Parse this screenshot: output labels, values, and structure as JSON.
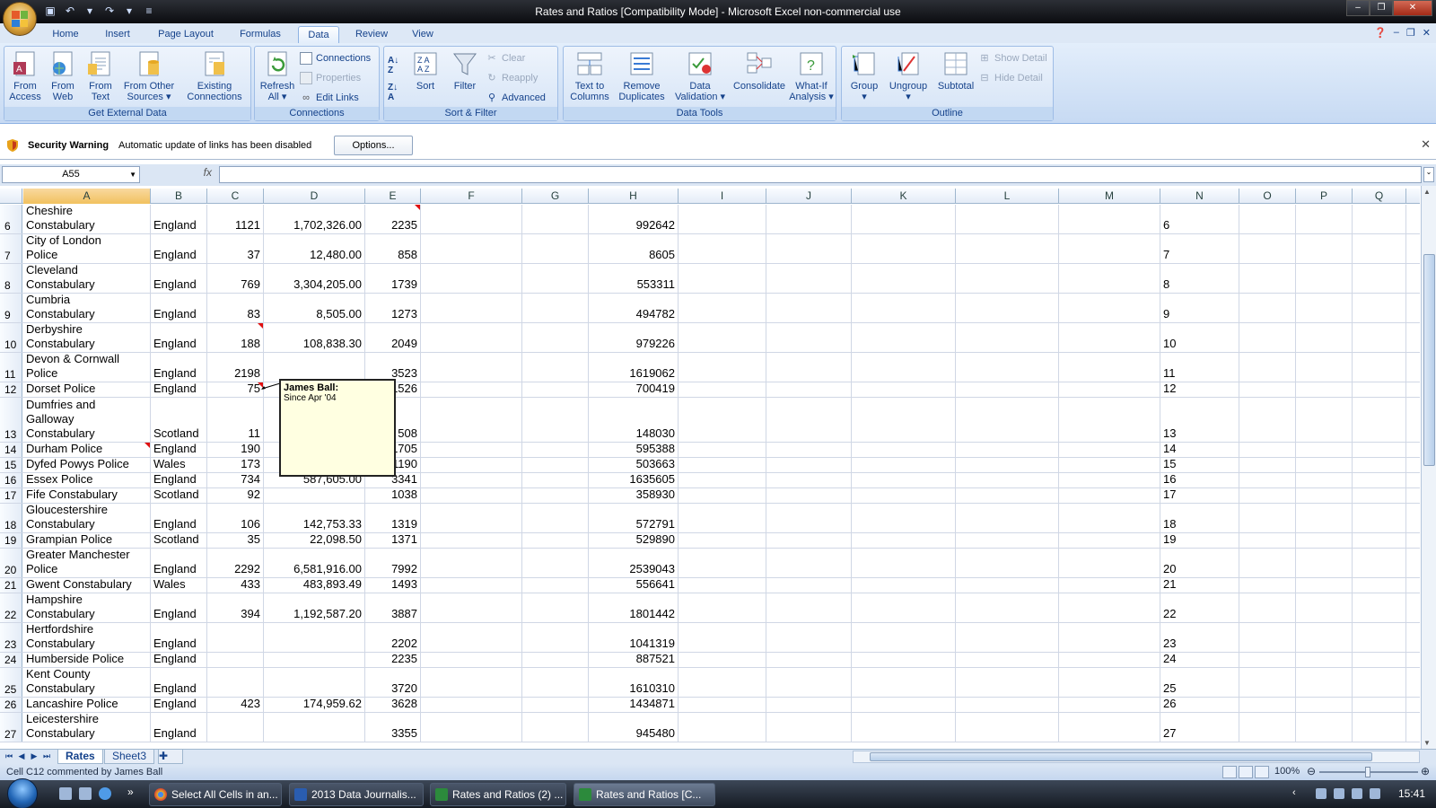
{
  "window": {
    "title": "Rates and Ratios  [Compatibility Mode] - Microsoft Excel non-commercial use"
  },
  "ribbon": {
    "tabs": [
      {
        "label": "Home"
      },
      {
        "label": "Insert"
      },
      {
        "label": "Page Layout"
      },
      {
        "label": "Formulas"
      },
      {
        "label": "Data",
        "active": true
      },
      {
        "label": "Review"
      },
      {
        "label": "View"
      }
    ],
    "groups": {
      "get_external_data": {
        "label": "Get External Data",
        "buttons": [
          {
            "label": "From\nAccess"
          },
          {
            "label": "From\nWeb"
          },
          {
            "label": "From\nText"
          },
          {
            "label": "From Other\nSources ▾"
          },
          {
            "label": "Existing\nConnections"
          }
        ]
      },
      "connections": {
        "label": "Connections",
        "refresh": "Refresh\nAll ▾",
        "connections": "Connections",
        "properties": "Properties",
        "edit_links": "Edit Links"
      },
      "sort_filter": {
        "label": "Sort & Filter",
        "sort": "Sort",
        "filter": "Filter",
        "clear": "Clear",
        "reapply": "Reapply",
        "advanced": "Advanced"
      },
      "data_tools": {
        "label": "Data Tools",
        "buttons": [
          {
            "label": "Text to\nColumns"
          },
          {
            "label": "Remove\nDuplicates"
          },
          {
            "label": "Data\nValidation ▾"
          },
          {
            "label": "Consolidate"
          },
          {
            "label": "What-If\nAnalysis ▾"
          }
        ]
      },
      "outline": {
        "label": "Outline",
        "buttons": [
          {
            "label": "Group\n▾"
          },
          {
            "label": "Ungroup\n▾"
          },
          {
            "label": "Subtotal"
          }
        ],
        "show_detail": "Show Detail",
        "hide_detail": "Hide Detail"
      }
    }
  },
  "security_bar": {
    "title": "Security Warning",
    "message": "Automatic update of links has been disabled",
    "options_button": "Options..."
  },
  "formula_bar": {
    "name_box": "A55",
    "fx": "fx",
    "formula": ""
  },
  "grid": {
    "columns": [
      "A",
      "B",
      "C",
      "D",
      "E",
      "F",
      "G",
      "H",
      "I",
      "J",
      "K",
      "L",
      "M",
      "N",
      "O",
      "P",
      "Q"
    ],
    "selected_column": "A",
    "rows": [
      {
        "n": "6",
        "a": "Cheshire\nConstabulary",
        "b": "England",
        "c": "1121",
        "d": "1,702,326.00",
        "e": "2235",
        "h": "992642"
      },
      {
        "n": "7",
        "a": "City of London\nPolice",
        "b": "England",
        "c": "37",
        "d": "12,480.00",
        "e": "858",
        "h": "8605"
      },
      {
        "n": "8",
        "a": "Cleveland\nConstabulary",
        "b": "England",
        "c": "769",
        "d": "3,304,205.00",
        "e": "1739",
        "h": "553311"
      },
      {
        "n": "9",
        "a": "Cumbria\nConstabulary",
        "b": "England",
        "c": "83",
        "d": "8,505.00",
        "e": "1273",
        "h": "494782"
      },
      {
        "n": "10",
        "a": "Derbyshire\nConstabulary",
        "b": "England",
        "c": "188",
        "d": "108,838.30",
        "e": "2049",
        "h": "979226"
      },
      {
        "n": "11",
        "a": "Devon & Cornwall\nPolice",
        "b": "England",
        "c": "2198",
        "d": "",
        "e": "3523",
        "h": "1619062"
      },
      {
        "n": "12",
        "a": "Dorset Police",
        "b": "England",
        "c": "75",
        "d": "",
        "e": "1526",
        "h": "700419"
      },
      {
        "n": "13",
        "a": "Dumfries and\nGalloway\nConstabulary",
        "b": "Scotland",
        "c": "11",
        "d": "",
        "e": "508",
        "h": "148030"
      },
      {
        "n": "14",
        "a": "Durham Police",
        "b": "England",
        "c": "190",
        "d": "",
        "e": "1705",
        "h": "595388"
      },
      {
        "n": "15",
        "a": "Dyfed Powys Police",
        "b": "Wales",
        "c": "173",
        "d": "",
        "e": "1190",
        "h": "503663"
      },
      {
        "n": "16",
        "a": "Essex Police",
        "b": "England",
        "c": "734",
        "d": "587,605.00",
        "e": "3341",
        "h": "1635605"
      },
      {
        "n": "17",
        "a": "Fife Constabulary",
        "b": "Scotland",
        "c": "92",
        "d": "",
        "e": "1038",
        "h": "358930"
      },
      {
        "n": "18",
        "a": "Gloucestershire\nConstabulary",
        "b": "England",
        "c": "106",
        "d": "142,753.33",
        "e": "1319",
        "h": "572791"
      },
      {
        "n": "19",
        "a": "Grampian Police",
        "b": "Scotland",
        "c": "35",
        "d": "22,098.50",
        "e": "1371",
        "h": "529890"
      },
      {
        "n": "20",
        "a": "Greater Manchester\nPolice",
        "b": "England",
        "c": "2292",
        "d": "6,581,916.00",
        "e": "7992",
        "h": "2539043"
      },
      {
        "n": "21",
        "a": "Gwent Constabulary",
        "b": "Wales",
        "c": "433",
        "d": "483,893.49",
        "e": "1493",
        "h": "556641"
      },
      {
        "n": "22",
        "a": "Hampshire\nConstabulary",
        "b": "England",
        "c": "394",
        "d": "1,192,587.20",
        "e": "3887",
        "h": "1801442"
      },
      {
        "n": "23",
        "a": "Hertfordshire\nConstabulary",
        "b": "England",
        "c": "",
        "d": "",
        "e": "2202",
        "h": "1041319"
      },
      {
        "n": "24",
        "a": "Humberside Police",
        "b": "England",
        "c": "",
        "d": "",
        "e": "2235",
        "h": "887521"
      },
      {
        "n": "25",
        "a": "Kent County\nConstabulary",
        "b": "England",
        "c": "",
        "d": "",
        "e": "3720",
        "h": "1610310"
      },
      {
        "n": "26",
        "a": "Lancashire Police",
        "b": "England",
        "c": "423",
        "d": "174,959.62",
        "e": "3628",
        "h": "1434871"
      },
      {
        "n": "27",
        "a": "Leicestershire\nConstabulary",
        "b": "England",
        "c": "",
        "d": "",
        "e": "3355",
        "h": "945480"
      }
    ]
  },
  "comment": {
    "author": "James Ball:",
    "text": "Since Apr '04"
  },
  "sheets": {
    "tabs": [
      {
        "label": "Rates",
        "active": true
      },
      {
        "label": "Sheet3"
      }
    ]
  },
  "status": {
    "text": "Cell C12 commented by James Ball",
    "zoom": "100%",
    "zoom_level": 100
  },
  "taskbar": {
    "items": [
      {
        "label": "Select All Cells in an..."
      },
      {
        "label": "2013 Data Journalis..."
      },
      {
        "label": "Rates and Ratios (2) ..."
      },
      {
        "label": "Rates and Ratios  [C...",
        "active": true
      }
    ],
    "clock": "15:41"
  },
  "colors": {
    "ribbon_text": "#15428b",
    "selected_header": "#f1c15f",
    "comment_bg": "#ffffe1",
    "comment_marker": "#e01010"
  }
}
